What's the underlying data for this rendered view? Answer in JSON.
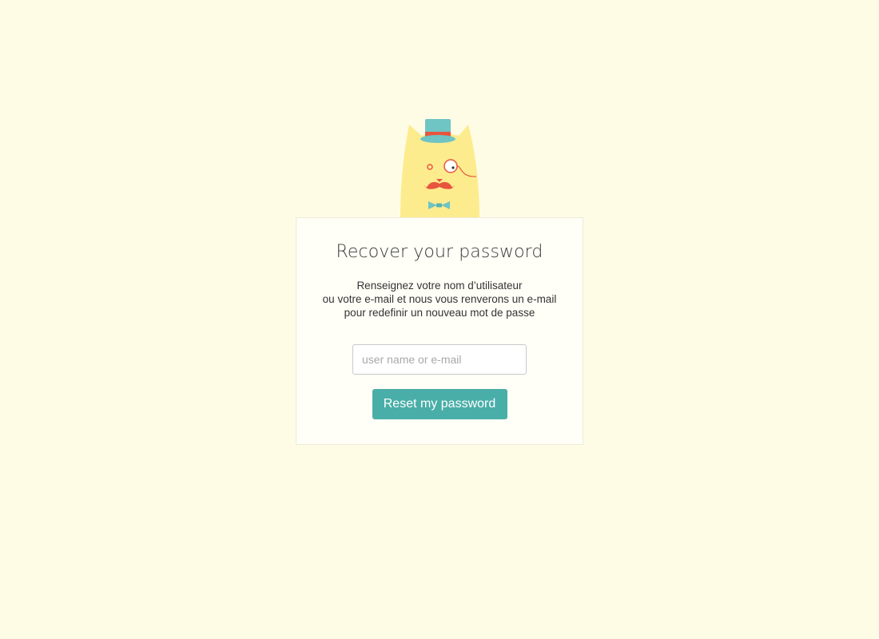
{
  "mascot": {
    "icon": "cat-mascot-icon",
    "colors": {
      "body": "#fdec8e",
      "hat": "#6fc4c4",
      "hat_band": "#e8553e",
      "mustache": "#e8553e",
      "bowtie": "#6fc4c4"
    }
  },
  "recover": {
    "title": "Recover your password",
    "description_lines": [
      "Renseignez votre nom d’utilisateur",
      "ou votre e-mail et nous vous renverons un e-mail",
      "pour redefinir un nouveau mot de passe"
    ],
    "input": {
      "value": "",
      "placeholder": "user name or e-mail"
    },
    "button_label": "Reset my password"
  },
  "colors": {
    "background": "#fffce6",
    "card": "#fffef7",
    "accent": "#4aaea8"
  }
}
